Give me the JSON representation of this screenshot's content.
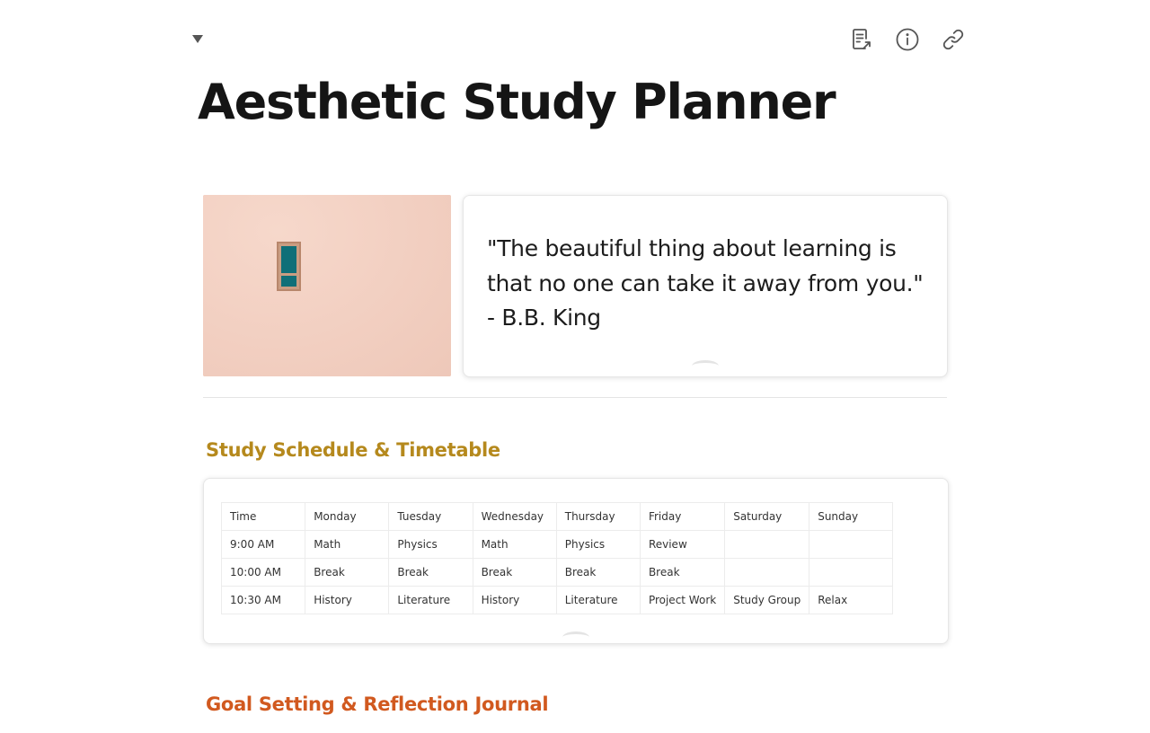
{
  "page": {
    "title": "Aesthetic Study Planner"
  },
  "header": {
    "actions": [
      {
        "name": "open-as-page",
        "icon": "document-share-icon"
      },
      {
        "name": "info",
        "icon": "info-icon"
      },
      {
        "name": "copy-link",
        "icon": "link-icon"
      }
    ]
  },
  "hero": {
    "image": "pink-wall-teal-window",
    "quote": "\"The beautiful thing about learning is that no one can take it away from you.\" - B.B. King"
  },
  "schedule_section": {
    "heading": "Study Schedule & Timetable",
    "heading_color": "#b5891d",
    "table": {
      "rows": [
        [
          "Time",
          "Monday",
          "Tuesday",
          "Wednesday",
          "Thursday",
          "Friday",
          "Saturday",
          "Sunday"
        ],
        [
          "9:00 AM",
          "Math",
          "Physics",
          "Math",
          "Physics",
          "Review",
          "",
          ""
        ],
        [
          "10:00 AM",
          "Break",
          "Break",
          "Break",
          "Break",
          "Break",
          "",
          ""
        ],
        [
          "10:30 AM",
          "History",
          "Literature",
          "History",
          "Literature",
          "Project Work",
          "Study Group",
          "Relax"
        ]
      ]
    }
  },
  "goals_section": {
    "heading": "Goal Setting & Reflection Journal",
    "heading_color": "#d1591f"
  }
}
